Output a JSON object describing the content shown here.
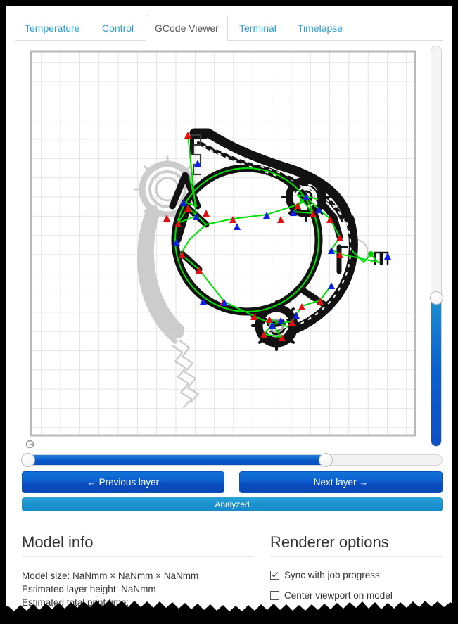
{
  "tabs": [
    {
      "label": "Temperature",
      "active": false
    },
    {
      "label": "Control",
      "active": false
    },
    {
      "label": "GCode Viewer",
      "active": true
    },
    {
      "label": "Terminal",
      "active": false
    },
    {
      "label": "Timelapse",
      "active": false
    }
  ],
  "viewer": {
    "layer_slider_value_pct": 37,
    "range_slider_value_pct": 72,
    "prev_layer_label": "Previous layer",
    "next_layer_label": "Next layer",
    "prev_arrow": "←",
    "next_arrow": "→",
    "progress_label": "Analyzed"
  },
  "model_info": {
    "title": "Model info",
    "lines": [
      "Model size: NaNmm × NaNmm × NaNmm",
      "Estimated layer height: NaNmm",
      "Estimated total print time: -"
    ]
  },
  "renderer_options": {
    "title": "Renderer options",
    "options": [
      {
        "label": "Sync with job progress",
        "checked": true
      },
      {
        "label": "Center viewport on model",
        "checked": false
      }
    ]
  },
  "colors": {
    "link": "#2a9fd6",
    "primary_button": "#0c5fd0",
    "progress_bar": "#1b92cf",
    "extrusion": "#000000",
    "travel": "#00ff00",
    "retract": "#ff0000",
    "restart": "#0000ff",
    "previous_layer": "#c8c8c8",
    "grid": "#cccccc"
  }
}
